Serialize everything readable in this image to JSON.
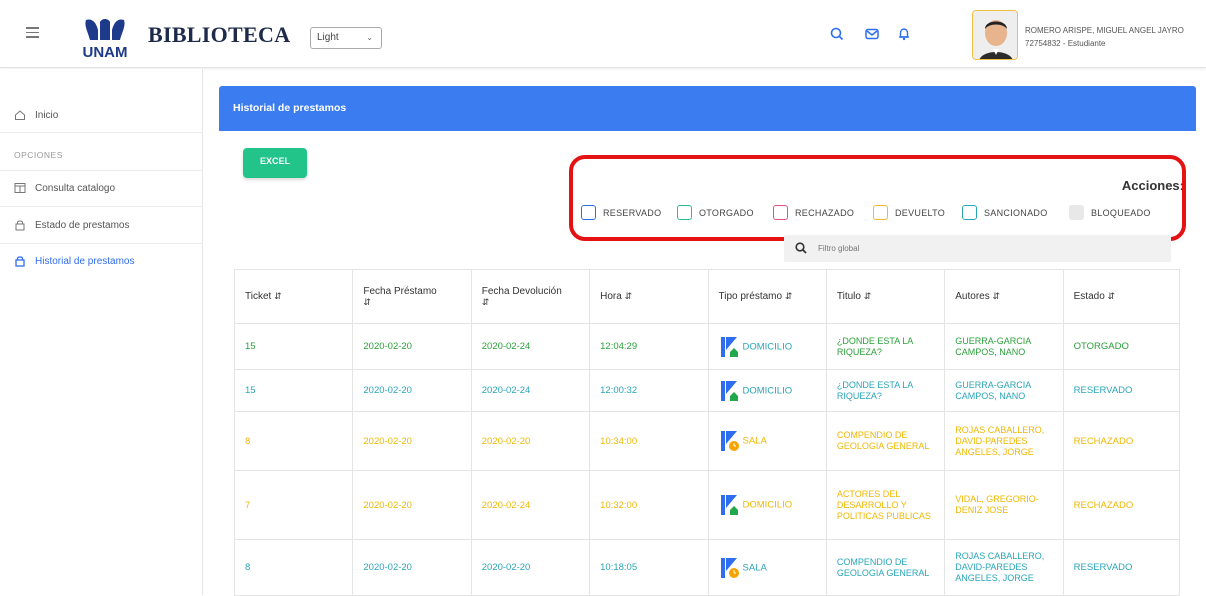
{
  "header": {
    "brand": "BIBLIOTECA",
    "logo_text": "UNAM",
    "theme_select": "Light",
    "user_name": "ROMERO ARISPE, MIGUEL ANGEL JAYRO",
    "user_sub": "72754832 - Estudiante"
  },
  "sidebar": {
    "home": "Inicio",
    "section": "OPCIONES",
    "items": [
      {
        "label": "Consulta catalogo"
      },
      {
        "label": "Estado de prestamos"
      },
      {
        "label": "Historial de prestamos"
      }
    ]
  },
  "main": {
    "title": "Historial de prestamos",
    "excel": "EXCEL",
    "acciones": "Acciones:",
    "legend": [
      {
        "label": "RESERVADO",
        "color": "#2f6df0"
      },
      {
        "label": "OTORGADO",
        "color": "#22c48a"
      },
      {
        "label": "RECHAZADO",
        "color": "#e8507a"
      },
      {
        "label": "DEVUELTO",
        "color": "#f5b82e"
      },
      {
        "label": "SANCIONADO",
        "color": "#2aa5b8"
      },
      {
        "label": "BLOQUEADO",
        "color": "#e6e6e6"
      }
    ],
    "filter_placeholder": "Filtro global"
  },
  "table": {
    "columns": [
      "Ticket",
      "Fecha Préstamo",
      "Fecha Devolución",
      "Hora",
      "Tipo préstamo",
      "Titulo",
      "Autores",
      "Estado"
    ],
    "rows": [
      {
        "ticket": "15",
        "fp": "2020-02-20",
        "fd": "2020-02-24",
        "hora": "12:04:29",
        "tipo": "DOMICILIO",
        "titulo": "¿DONDE ESTA LA RIQUEZA?",
        "autores": "GUERRA-GARCIA CAMPOS, NANO",
        "estado": "OTORGADO"
      },
      {
        "ticket": "15",
        "fp": "2020-02-20",
        "fd": "2020-02-24",
        "hora": "12:00:32",
        "tipo": "DOMICILIO",
        "titulo": "¿DONDE ESTA LA RIQUEZA?",
        "autores": "GUERRA-GARCIA CAMPOS, NANO",
        "estado": "RESERVADO"
      },
      {
        "ticket": "8",
        "fp": "2020-02-20",
        "fd": "2020-02-20",
        "hora": "10:34:00",
        "tipo": "SALA",
        "titulo": "COMPENDIO DE GEOLOGIA GENERAL",
        "autores": "ROJAS CABALLERO, DAVID-PAREDES ANGELES, JORGE",
        "estado": "RECHAZADO"
      },
      {
        "ticket": "7",
        "fp": "2020-02-20",
        "fd": "2020-02-24",
        "hora": "10:32:00",
        "tipo": "DOMICILIO",
        "titulo": "ACTORES DEL DESARROLLO Y POLITICAS PUBLICAS",
        "autores": "VIDAL, GREGORIO-DENIZ JOSE",
        "estado": "RECHAZADO"
      },
      {
        "ticket": "8",
        "fp": "2020-02-20",
        "fd": "2020-02-20",
        "hora": "10:18:05",
        "tipo": "SALA",
        "titulo": "COMPENDIO DE GEOLOGIA GENERAL",
        "autores": "ROJAS CABALLERO, DAVID-PAREDES ANGELES, JORGE",
        "estado": "RESERVADO"
      }
    ]
  }
}
